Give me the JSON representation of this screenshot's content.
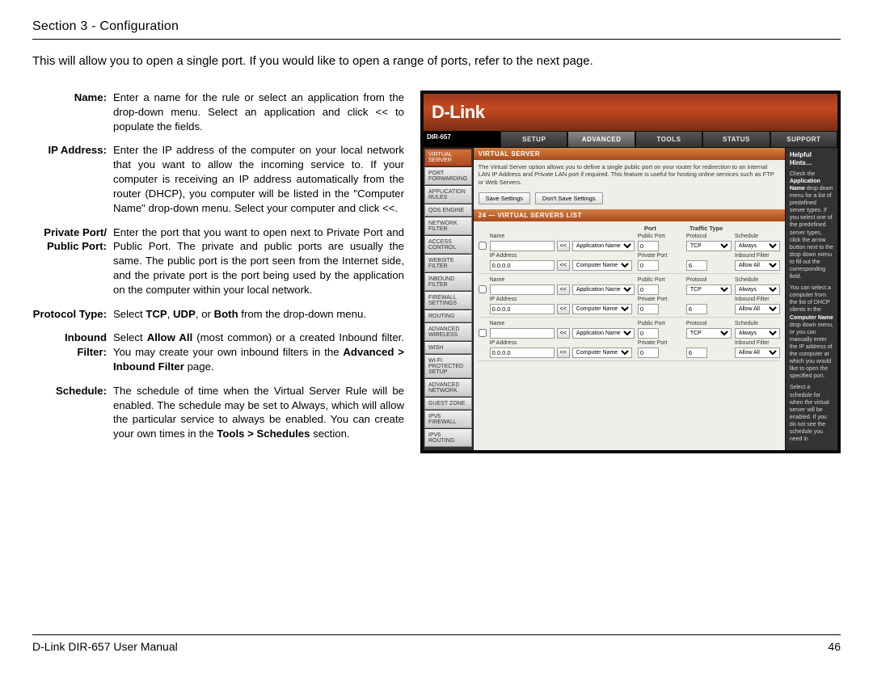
{
  "header": {
    "section": "Section 3 - Configuration"
  },
  "intro": "This will allow you to open a single port. If you would like to open a range of ports, refer to the next page.",
  "defs": {
    "name": {
      "label": "Name:",
      "desc": "Enter a name for the rule or select an application from the drop-down menu. Select an application and click << to populate the fields."
    },
    "ip": {
      "label": "IP Address:",
      "desc": "Enter the IP address of the computer on your local network that you want to allow the incoming service to. If your computer is receiving an IP address automatically from the router (DHCP), you computer will be listed in the \"Computer Name\" drop-down menu. Select your computer and click <<."
    },
    "port": {
      "label": "Private Port/ Public Port:",
      "desc": "Enter the port that you want to open next to Private Port and Public Port. The private and public ports are usually the same. The public port is the port seen from the Internet side, and the private port is the port being used by the application on the computer within your local network."
    },
    "proto": {
      "label": "Protocol Type:",
      "desc_a": "Select ",
      "tcp": "TCP",
      "c1": ", ",
      "udp": "UDP",
      "c2": ", or ",
      "both": "Both",
      "desc_b": " from the drop-down menu."
    },
    "inbound": {
      "label": "Inbound Filter:",
      "a": "Select ",
      "allow": "Allow All",
      "b": " (most common) or a created Inbound filter. You may create your own inbound filters in the ",
      "path": "Advanced > Inbound Filter",
      "c": " page."
    },
    "sched": {
      "label": "Schedule:",
      "a": "The schedule of time when the Virtual Server Rule will be enabled. The schedule may be set to Always, which will allow the particular service to always be enabled. You can create your own times in the ",
      "path": "Tools > Schedules",
      "b": " section."
    }
  },
  "router": {
    "logo": "D-Link",
    "model": "DIR-657",
    "tabs": [
      "SETUP",
      "ADVANCED",
      "TOOLS",
      "STATUS",
      "SUPPORT"
    ],
    "active_tab": 1,
    "side": [
      "VIRTUAL SERVER",
      "PORT FORWARDING",
      "APPLICATION RULES",
      "QOS ENGINE",
      "NETWORK FILTER",
      "ACCESS CONTROL",
      "WEBSITE FILTER",
      "INBOUND FILTER",
      "FIREWALL SETTINGS",
      "ROUTING",
      "ADVANCED WIRELESS",
      "WISH",
      "WI-FI PROTECTED SETUP",
      "ADVANCED NETWORK",
      "GUEST ZONE",
      "IPV6 FIREWALL",
      "IPV6 ROUTING"
    ],
    "sec_title": "VIRTUAL SERVER",
    "sec_desc": "The Virtual Server option allows you to define a single public port on your router for redirection to an internal LAN IP Address and Private LAN port if required. This feature is useful for hosting online services such as FTP or Web Servers.",
    "save": "Save Settings",
    "dont": "Don't Save Settings",
    "list_title": "24 — VIRTUAL SERVERS LIST",
    "col_port": "Port",
    "col_traffic": "Traffic Type",
    "row": {
      "name": "Name",
      "ip": "IP Address",
      "ipval": "0.0.0.0",
      "appbtn": "<<",
      "appsel": "Application Name",
      "compsel": "Computer Name",
      "pub": "Public Port",
      "priv": "Private Port",
      "pubval": "0",
      "privval": "0",
      "proto": "Protocol",
      "tcp": "TCP",
      "sched": "Schedule",
      "always": "Always",
      "inb": "Inbound Filter",
      "allow": "Allow All"
    },
    "hints": {
      "title": "Helpful Hints…",
      "p1a": "Check the ",
      "p1b": "Application Name",
      "p1c": " drop down menu for a list of predefined server types. If you select one of the predefined server types, click the arrow button next to the drop down menu to fill out the corresponding field.",
      "p2a": "You can select a computer from the list of DHCP clients in the ",
      "p2b": "Computer Name",
      "p2c": " drop down menu, or you can manually enter the IP address of the computer at which you would like to open the specified port.",
      "p3": "Select a schedule for when the virtual server will be enabled. If you do not see the schedule you need in"
    }
  },
  "footer": {
    "left": "D-Link DIR-657 User Manual",
    "page": "46"
  }
}
